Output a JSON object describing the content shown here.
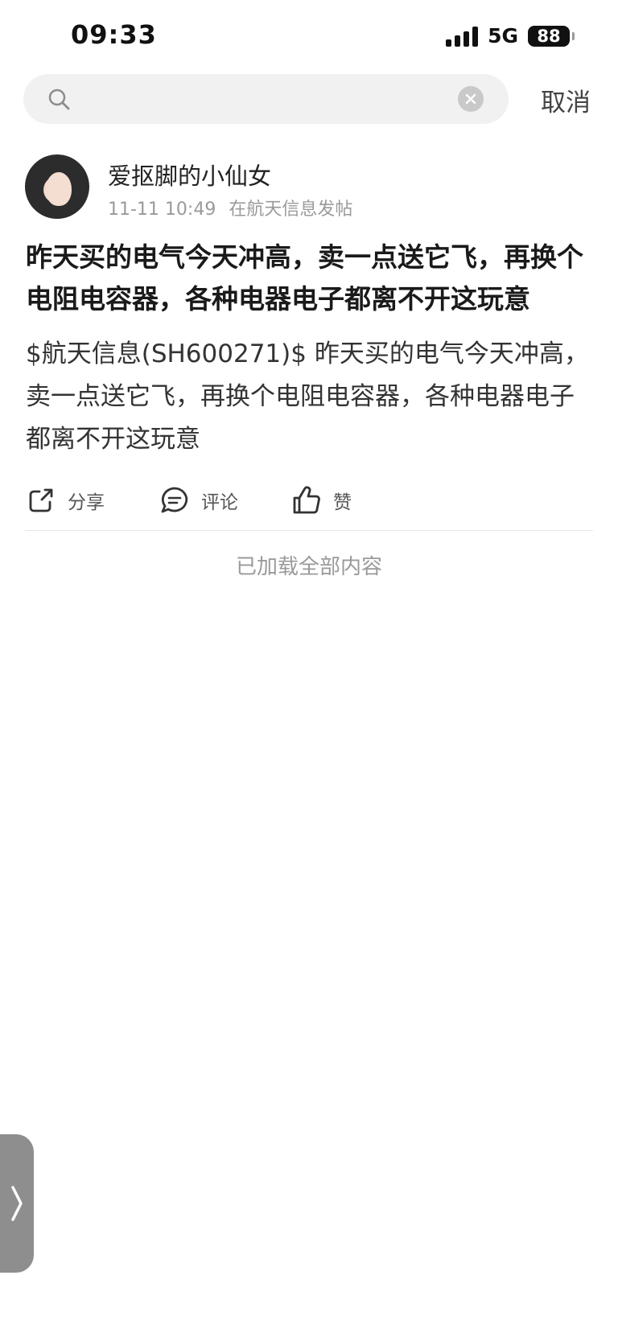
{
  "status_bar": {
    "time": "09:33",
    "network": "5G",
    "battery": "88",
    "icons": [
      "signal-icon",
      "battery-icon"
    ]
  },
  "search": {
    "value": "",
    "placeholder": "",
    "cancel_label": "取消",
    "icons": [
      "search-icon",
      "clear-icon"
    ]
  },
  "post": {
    "author": "爱抠脚的小仙女",
    "date": "11-11 10:49",
    "source": "在航天信息发帖",
    "title": "昨天买的电气今天冲高，卖一点送它飞，再换个电阻电容器，各种电器电子都离不开这玩意",
    "body": "$航天信息(SH600271)$ 昨天买的电气今天冲高，卖一点送它飞，再换个电阻电容器，各种电器电子都离不开这玩意",
    "actions": {
      "share": "分享",
      "comment": "评论",
      "like": "赞"
    }
  },
  "footer_note": "已加载全部内容",
  "colors": {
    "accent_text": "#222222",
    "muted_text": "#9a9a9a",
    "search_bg": "#f1f1f1",
    "side_tab": "#8e8e8e"
  }
}
